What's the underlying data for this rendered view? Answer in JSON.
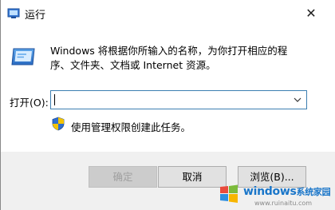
{
  "window": {
    "title": "运行",
    "close_glyph": "✕"
  },
  "dialog": {
    "description": "Windows 将根据你所输入的名称，为你打开相应的程序、文件夹、文档或 Internet 资源。",
    "open_label": "打开(O):",
    "open_value": "",
    "admin_note": "使用管理权限创建此任务。"
  },
  "buttons": {
    "ok": "确定",
    "cancel": "取消",
    "browse": "浏览(B)..."
  },
  "watermark": {
    "brand": "windows",
    "suffix": "系统家园",
    "url": "www.ruinaitu.com"
  },
  "icons": {
    "app": "run-icon",
    "run_large": "run-icon",
    "dropdown": "chevron-down-icon",
    "shield": "uac-shield-icon",
    "close": "close-icon"
  },
  "colors": {
    "accent_border": "#3c7fb1",
    "watermark_blue": "#1a76c9",
    "footer_bg": "#f0f0f0"
  }
}
